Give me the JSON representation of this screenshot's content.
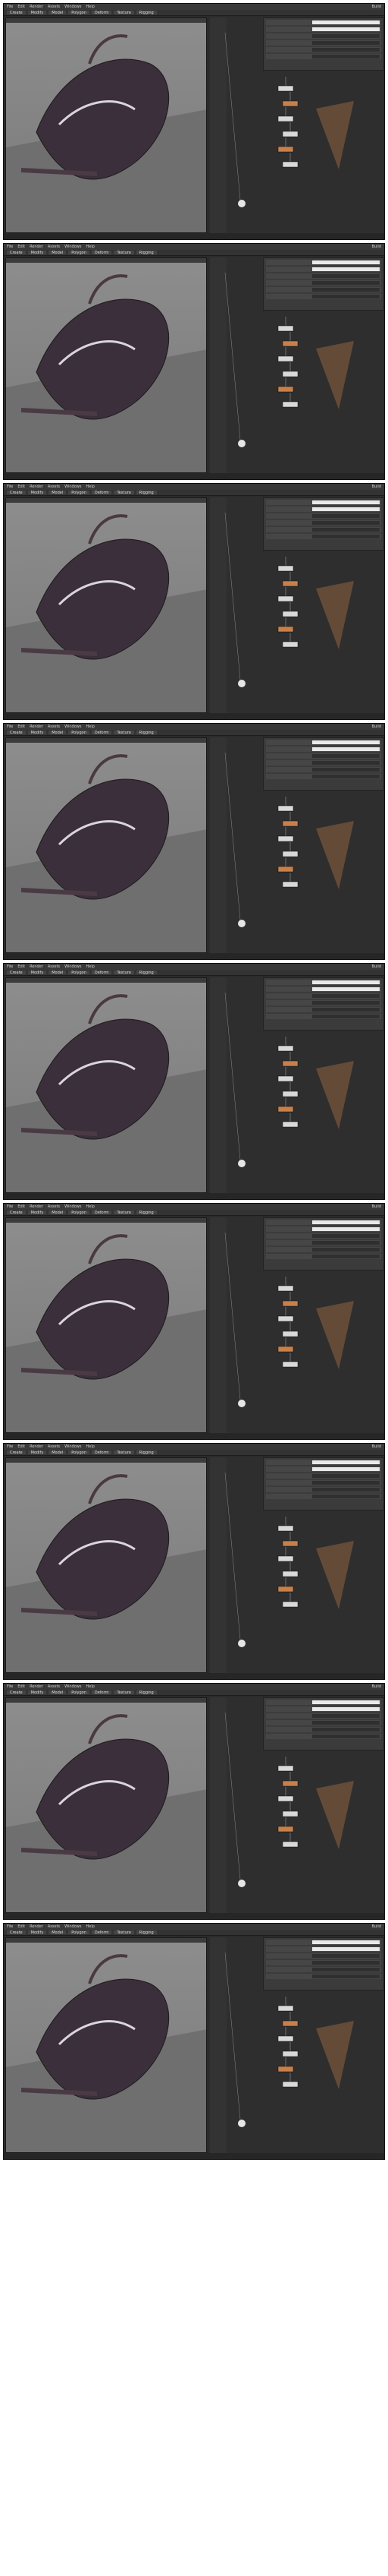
{
  "app": {
    "menu": [
      "File",
      "Edit",
      "Render",
      "Assets",
      "Windows",
      "Help"
    ],
    "desktop_label": "Build",
    "shelf_tabs": [
      "Create",
      "Modify",
      "Model",
      "Polygon",
      "Deform",
      "Texture",
      "Rigging"
    ],
    "status_text": "",
    "accent_color": "#c8804a",
    "node_color": "#d9d9d9"
  },
  "frames": [
    {
      "id": 1,
      "title": ""
    },
    {
      "id": 2,
      "title": ""
    },
    {
      "id": 3,
      "title": ""
    },
    {
      "id": 4,
      "title": ""
    },
    {
      "id": 5,
      "title": ""
    },
    {
      "id": 6,
      "title": ""
    },
    {
      "id": 7,
      "title": ""
    },
    {
      "id": 8,
      "title": ""
    },
    {
      "id": 9,
      "title": ""
    }
  ],
  "params": {
    "rows": [
      "",
      "",
      "",
      "",
      "",
      ""
    ]
  }
}
